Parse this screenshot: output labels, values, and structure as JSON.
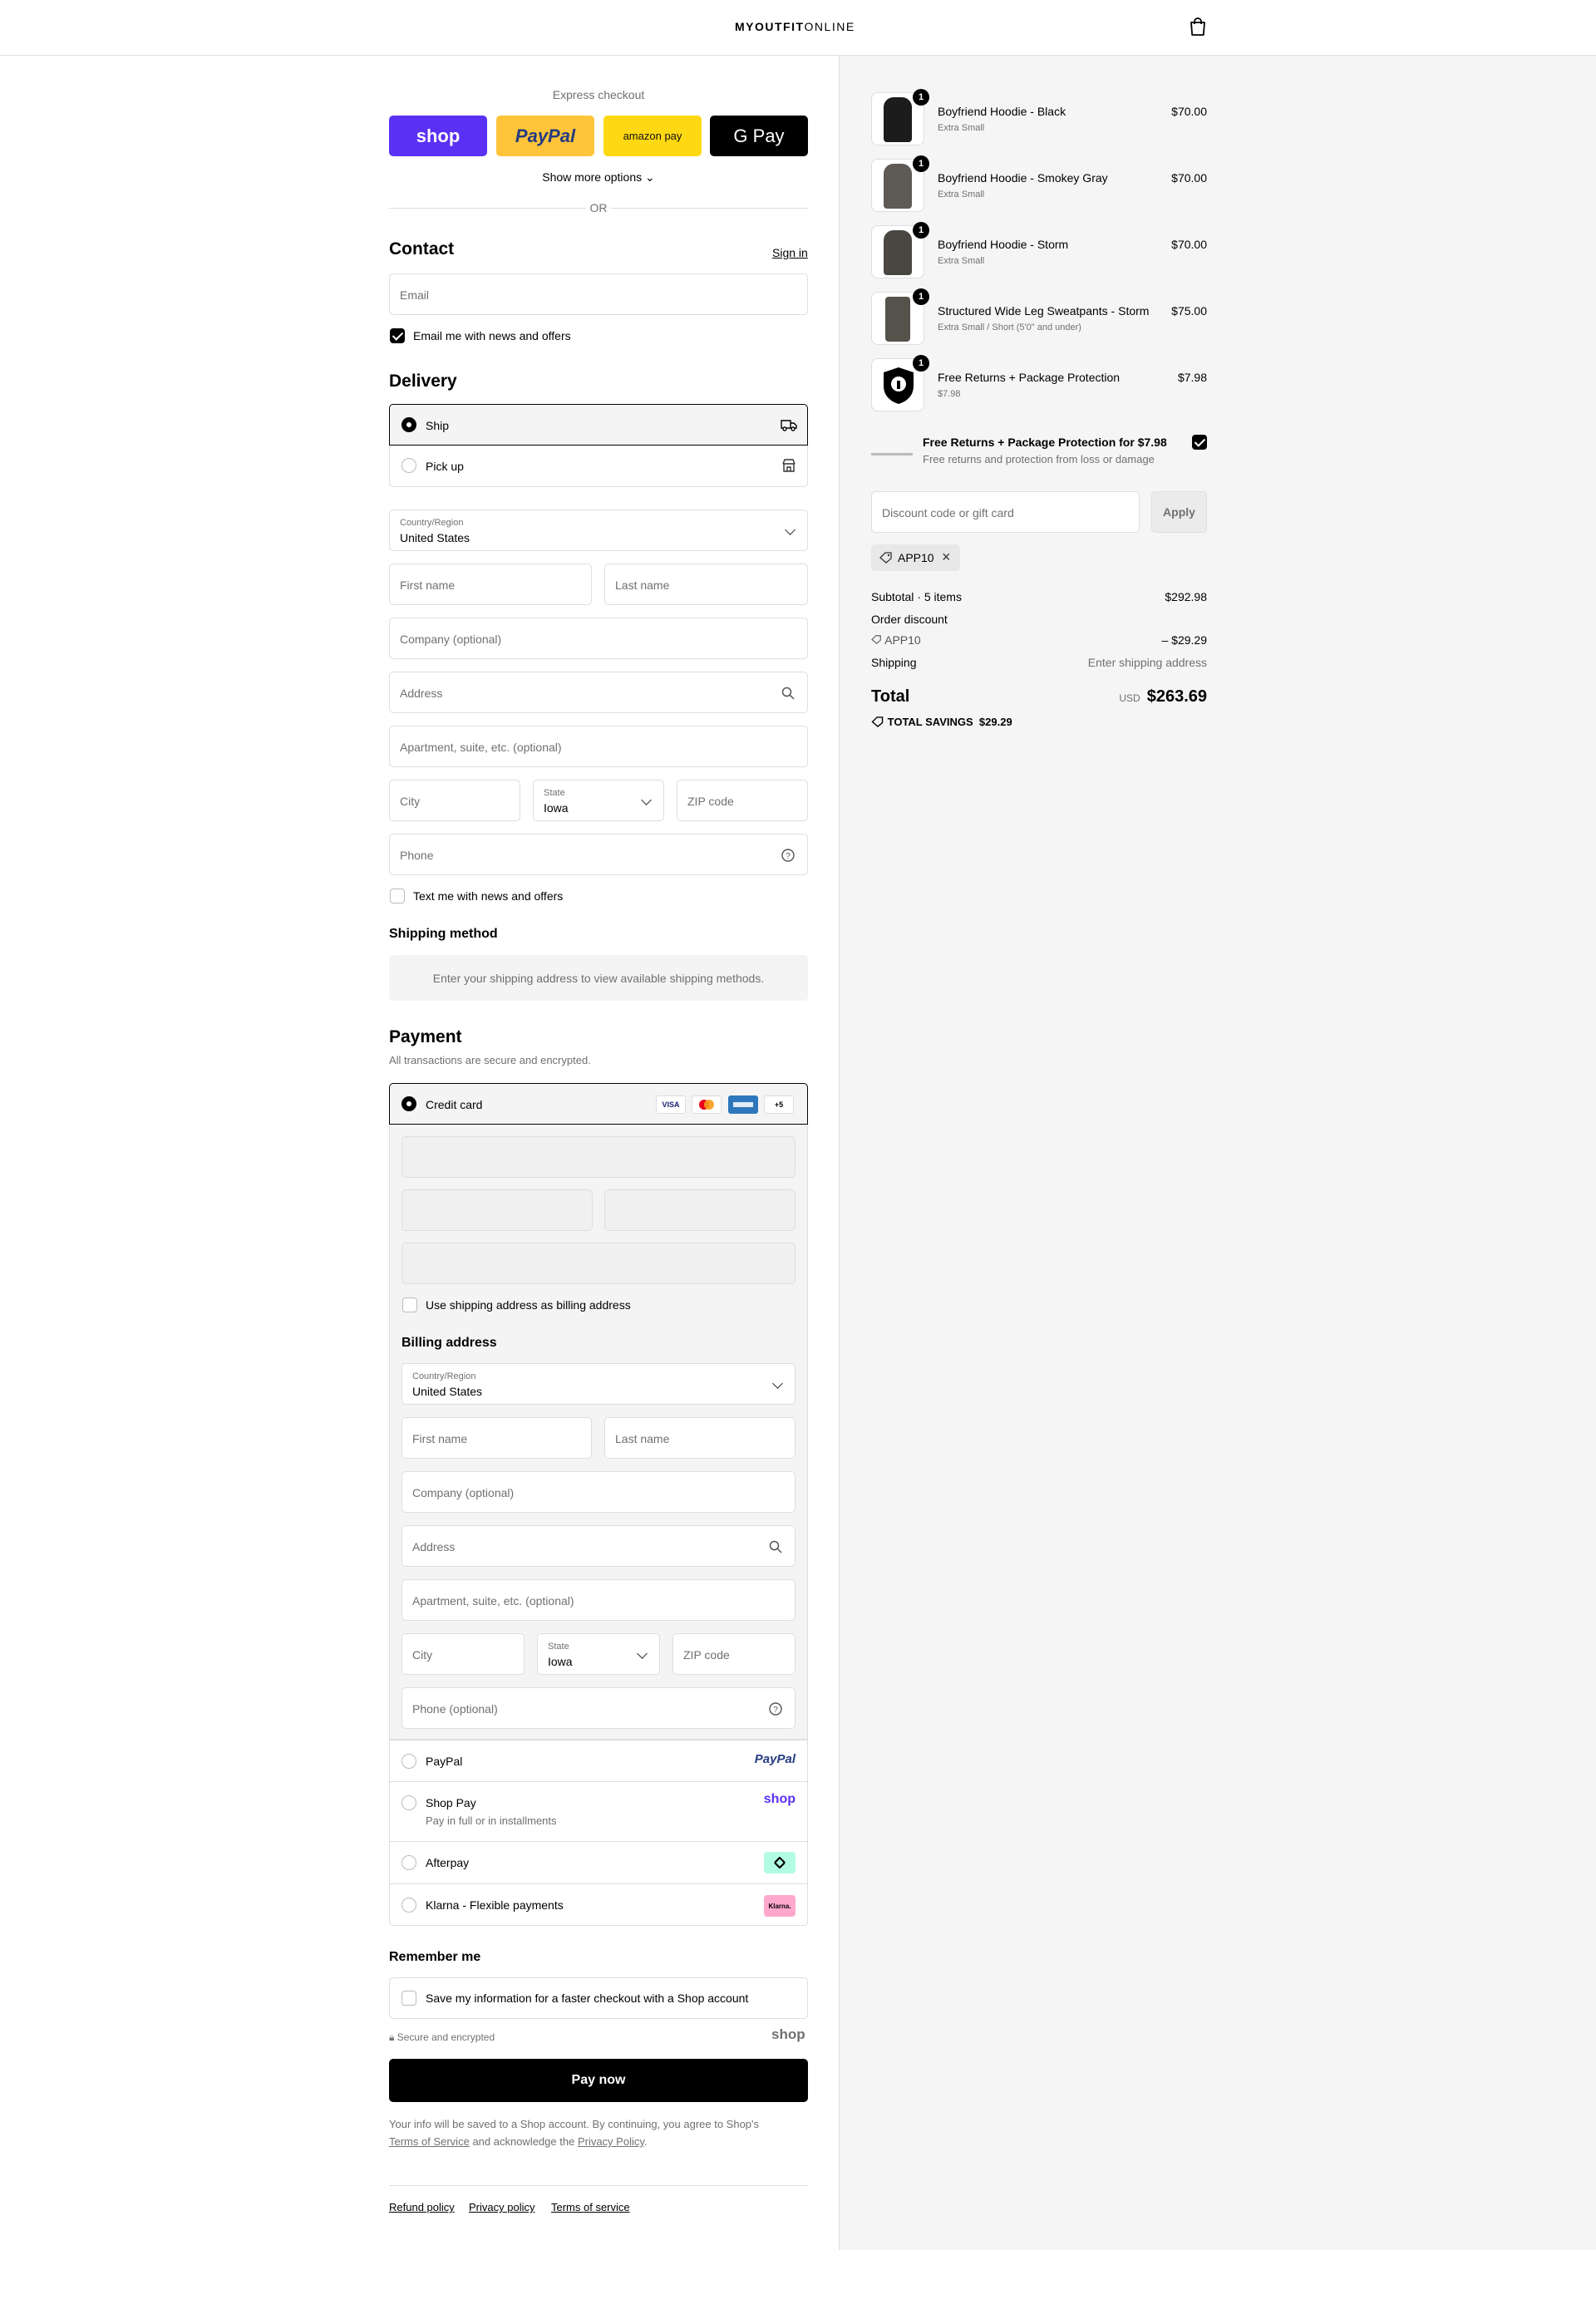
{
  "header": {
    "brand_bold": "MYOUTFIT",
    "brand_mid": "ONLINE",
    "cart_icon": "shopping-bag-icon"
  },
  "express": {
    "label": "Express checkout",
    "buttons": {
      "shop": "shop",
      "paypal": "PayPal",
      "amazon": "amazon pay",
      "gpay": "G Pay"
    },
    "show_more": "Show more options",
    "or": "OR"
  },
  "contact": {
    "title": "Contact",
    "sign_in": "Sign in",
    "email_placeholder": "Email",
    "news_label": "Email me with news and offers",
    "news_checked": true
  },
  "delivery": {
    "title": "Delivery",
    "options": [
      {
        "label": "Ship",
        "selected": true,
        "icon": "truck-icon"
      },
      {
        "label": "Pick up",
        "selected": false,
        "icon": "store-icon"
      }
    ],
    "country_label": "Country/Region",
    "country_value": "United States",
    "first_name": "First name",
    "last_name": "Last name",
    "company": "Company (optional)",
    "address": "Address",
    "apartment": "Apartment, suite, etc. (optional)",
    "city": "City",
    "state_label": "State",
    "state_value": "Iowa",
    "zip": "ZIP code",
    "phone": "Phone",
    "text_label": "Text me with news and offers"
  },
  "shipping_method": {
    "title": "Shipping method",
    "message": "Enter your shipping address to view available shipping methods."
  },
  "payment": {
    "title": "Payment",
    "subtitle": "All transactions are secure and encrypted.",
    "credit_card_label": "Credit card",
    "card_badges": {
      "visa": "VISA",
      "more": "+5"
    },
    "use_shipping": "Use shipping address as billing address",
    "billing_title": "Billing address",
    "billing": {
      "country_label": "Country/Region",
      "country_value": "United States",
      "first_name": "First name",
      "last_name": "Last name",
      "company": "Company (optional)",
      "address": "Address",
      "apartment": "Apartment, suite, etc. (optional)",
      "city": "City",
      "state_label": "State",
      "state_value": "Iowa",
      "zip": "ZIP code",
      "phone": "Phone (optional)"
    },
    "methods": {
      "paypal": {
        "label": "PayPal",
        "logo": "PayPal"
      },
      "shoppay": {
        "label": "Shop Pay",
        "sub": "Pay in full or in installments",
        "logo": "shop"
      },
      "afterpay": {
        "label": "Afterpay"
      },
      "klarna": {
        "label": "Klarna - Flexible payments",
        "logo": "Klarna."
      }
    }
  },
  "remember": {
    "title": "Remember me",
    "save_label": "Save my information for a faster checkout with a Shop account",
    "secure": "Secure and encrypted",
    "shop_logo": "shop"
  },
  "pay_now": "Pay now",
  "legal": {
    "line1": "Your info will be saved to a Shop account. By continuing, you agree to Shop's",
    "terms": "Terms of Service",
    "and": "and acknowledge the",
    "privacy": "Privacy Policy",
    "end": "."
  },
  "footer_links": [
    "Refund policy",
    "Privacy policy",
    "Terms of service"
  ],
  "cart": {
    "items": [
      {
        "name": "Boyfriend Hoodie - Black",
        "variant": "Extra Small",
        "price": "$70.00",
        "qty": "1",
        "color": "#1c1c1c"
      },
      {
        "name": "Boyfriend Hoodie - Smokey Gray",
        "variant": "Extra Small",
        "price": "$70.00",
        "qty": "1",
        "color": "#5e5a55"
      },
      {
        "name": "Boyfriend Hoodie - Storm",
        "variant": "Extra Small",
        "price": "$70.00",
        "qty": "1",
        "color": "#4a4742"
      },
      {
        "name": "Structured Wide Leg Sweatpants - Storm",
        "variant": "Extra Small / Short (5'0\" and under)",
        "price": "$75.00",
        "qty": "1",
        "color": "#55514b"
      },
      {
        "name": "Free Returns + Package Protection",
        "variant": "$7.98",
        "price": "$7.98",
        "qty": "1",
        "color": "#000000"
      }
    ],
    "protection_title": "Free Returns + Package Protection for $7.98",
    "protection_sub": "Free returns and protection from loss or damage",
    "protection_checked": true,
    "discount_placeholder": "Discount code or gift card",
    "apply": "Apply",
    "applied_code": "APP10",
    "subtotal_label": "Subtotal · 5 items",
    "subtotal": "$292.98",
    "order_discount": "Order discount",
    "discount_code": "APP10",
    "discount_amount": "– $29.29",
    "shipping_label": "Shipping",
    "shipping_value": "Enter shipping address",
    "total_label": "Total",
    "currency": "USD",
    "total": "$263.69",
    "savings_label": "TOTAL SAVINGS",
    "savings": "$29.29"
  }
}
